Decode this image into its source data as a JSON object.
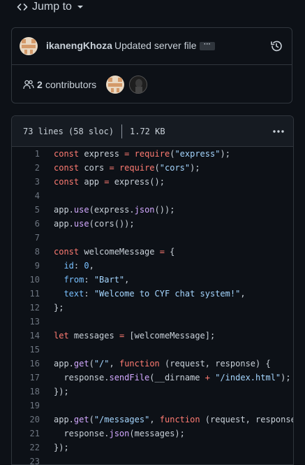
{
  "nav": {
    "jump_label": "Jump to"
  },
  "commit": {
    "author": "ikanengKhoza",
    "message": "Updated server file",
    "more_label": "···"
  },
  "contributors": {
    "count": "2",
    "label": "contributors"
  },
  "file": {
    "lines_info": "73 lines (58 sloc)",
    "size": "1.72 KB"
  },
  "colors": {
    "background": "#0d1117",
    "border": "#30363d",
    "keyword": "#ff7b72",
    "string": "#a5d6ff",
    "function": "#d2a8ff",
    "number": "#79c0ff"
  },
  "icons": {
    "code": "code-icon",
    "history": "history-icon",
    "people": "people-icon",
    "kebab": "kebab-horizontal-icon"
  },
  "code_lines": [
    {
      "n": "1",
      "tokens": [
        [
          "k",
          "const"
        ],
        [
          "i",
          " express "
        ],
        [
          "k",
          "="
        ],
        [
          "i",
          " "
        ],
        [
          "k",
          "require"
        ],
        [
          "p",
          "("
        ],
        [
          "s",
          "\"express\""
        ],
        [
          "p",
          ");"
        ]
      ]
    },
    {
      "n": "2",
      "tokens": [
        [
          "k",
          "const"
        ],
        [
          "i",
          " cors "
        ],
        [
          "k",
          "="
        ],
        [
          "i",
          " "
        ],
        [
          "k",
          "require"
        ],
        [
          "p",
          "("
        ],
        [
          "s",
          "\"cors\""
        ],
        [
          "p",
          ");"
        ]
      ]
    },
    {
      "n": "3",
      "tokens": [
        [
          "k",
          "const"
        ],
        [
          "i",
          " app "
        ],
        [
          "k",
          "="
        ],
        [
          "i",
          " express();"
        ]
      ]
    },
    {
      "n": "4",
      "tokens": []
    },
    {
      "n": "5",
      "tokens": [
        [
          "i",
          "app."
        ],
        [
          "f",
          "use"
        ],
        [
          "p",
          "(express."
        ],
        [
          "f",
          "json"
        ],
        [
          "p",
          "());"
        ]
      ]
    },
    {
      "n": "6",
      "tokens": [
        [
          "i",
          "app."
        ],
        [
          "f",
          "use"
        ],
        [
          "p",
          "(cors());"
        ]
      ]
    },
    {
      "n": "7",
      "tokens": []
    },
    {
      "n": "8",
      "tokens": [
        [
          "k",
          "const"
        ],
        [
          "i",
          " welcomeMessage "
        ],
        [
          "k",
          "="
        ],
        [
          "i",
          " {"
        ]
      ]
    },
    {
      "n": "9",
      "tokens": [
        [
          "i",
          "  "
        ],
        [
          "c",
          "id"
        ],
        [
          "p",
          ": "
        ],
        [
          "c",
          "0"
        ],
        [
          "p",
          ","
        ]
      ]
    },
    {
      "n": "10",
      "tokens": [
        [
          "i",
          "  "
        ],
        [
          "c",
          "from"
        ],
        [
          "p",
          ": "
        ],
        [
          "s",
          "\"Bart\""
        ],
        [
          "p",
          ","
        ]
      ]
    },
    {
      "n": "11",
      "tokens": [
        [
          "i",
          "  "
        ],
        [
          "c",
          "text"
        ],
        [
          "p",
          ": "
        ],
        [
          "s",
          "\"Welcome to CYF chat system!\""
        ],
        [
          "p",
          ","
        ]
      ]
    },
    {
      "n": "12",
      "tokens": [
        [
          "p",
          "};"
        ]
      ]
    },
    {
      "n": "13",
      "tokens": []
    },
    {
      "n": "14",
      "tokens": [
        [
          "k",
          "let"
        ],
        [
          "i",
          " messages "
        ],
        [
          "k",
          "="
        ],
        [
          "i",
          " [welcomeMessage];"
        ]
      ]
    },
    {
      "n": "15",
      "tokens": []
    },
    {
      "n": "16",
      "tokens": [
        [
          "i",
          "app."
        ],
        [
          "f",
          "get"
        ],
        [
          "p",
          "("
        ],
        [
          "s",
          "\"/\""
        ],
        [
          "p",
          ", "
        ],
        [
          "k",
          "function"
        ],
        [
          "i",
          " (request, response) {"
        ]
      ]
    },
    {
      "n": "17",
      "tokens": [
        [
          "i",
          "  response."
        ],
        [
          "f",
          "sendFile"
        ],
        [
          "p",
          "(__dirname "
        ],
        [
          "k",
          "+"
        ],
        [
          "i",
          " "
        ],
        [
          "s",
          "\"/index.html\""
        ],
        [
          "p",
          ");"
        ]
      ]
    },
    {
      "n": "18",
      "tokens": [
        [
          "p",
          "});"
        ]
      ]
    },
    {
      "n": "19",
      "tokens": []
    },
    {
      "n": "20",
      "tokens": [
        [
          "i",
          "app."
        ],
        [
          "f",
          "get"
        ],
        [
          "p",
          "("
        ],
        [
          "s",
          "\"/messages\""
        ],
        [
          "p",
          ", "
        ],
        [
          "k",
          "function"
        ],
        [
          "i",
          " (request, response"
        ]
      ]
    },
    {
      "n": "21",
      "tokens": [
        [
          "i",
          "  response."
        ],
        [
          "f",
          "json"
        ],
        [
          "p",
          "(messages);"
        ]
      ]
    },
    {
      "n": "22",
      "tokens": [
        [
          "p",
          "});"
        ]
      ]
    },
    {
      "n": "23",
      "tokens": []
    }
  ]
}
